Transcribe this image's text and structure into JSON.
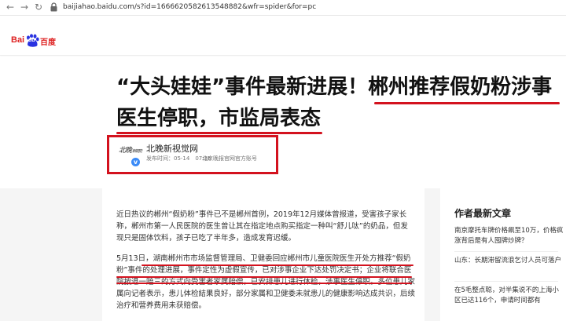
{
  "browser": {
    "url": "baijiahao.baidu.com/s?id=1666620582613548882&wfr=spider&for=pc"
  },
  "header": {
    "logo_bai": "Bai",
    "logo_du": "du",
    "logo_cn": "百度"
  },
  "article": {
    "title_line1": "“大头娃娃”事件最新进展！郴州推荐假奶粉涉事",
    "title_line2": "医生停职，市监局表态",
    "author": {
      "logo_text": "北晚",
      "logo_sub": "新视觉",
      "name": "北晚新视觉网",
      "publish_time": "发布时间：05-14　07:36",
      "description": "北京晚报官网官方账号"
    },
    "paragraphs": [
      "近日热议的郴州“假奶粉”事件已不是郴州首例，2019年12月媒体曾报道，受害孩子家长称，郴州市第一人民医院的医生曾让其在指定地点购买指定一种叫“舒儿呔”的奶品，但发现只是固体饮料，孩子已吃了半年多，造成发育迟缓。",
      "5月13日，湖南郴州市市场监督管理局、卫健委回应郴州市儿童医院医生开处方推荐“假奶粉”事件的处理进展，事件定性为虚假宣传，已对涉事企业下达处罚决定书；企业将联合医院按退一赔三的方式向受害者家属赔偿，已安排患儿进行体检，涉事医生停职。多位患儿家属向记者表示，患儿体检結果良好，部分家属和卫健委未就患儿的健康影响达成共识，后续治疗和营养费用未获赔偿。"
    ]
  },
  "sidebar": {
    "title": "作者最新文章",
    "items": [
      "南京摩托车牌价格飙至10万，价格疯涨背后是有人囤牌炒牌？",
      "山东：长期滞留流浪乞讨人员可落户",
      "在5毛整点聪，对半集说不的上海小区已达116个，申请时间都有"
    ]
  },
  "colors": {
    "accent_red": "#d3121e",
    "baidu_red": "#de2121",
    "baidu_blue": "#2932e1"
  }
}
